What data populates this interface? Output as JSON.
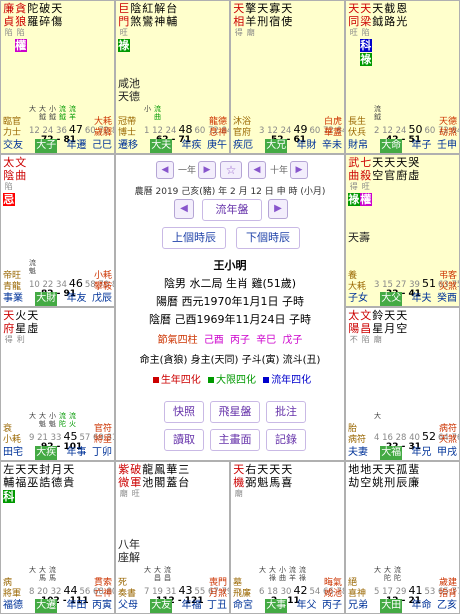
{
  "colors": {
    "lu": "#009900",
    "quan": "#cc00cc",
    "ke": "#0000cc",
    "ji": "#ff0000",
    "decade": "#44aa44",
    "highlight": "#ffffcc"
  },
  "palaces": [
    {
      "id": "jisi",
      "stars": [
        {
          "name": "廉貞",
          "color": "#cc0000",
          "sub": "陷"
        },
        {
          "name": "貪狼",
          "color": "#cc0000",
          "sub": "陷",
          "hua": "權",
          "hua_bg": "#cc00cc"
        },
        {
          "name": "陀羅",
          "color": "#000000"
        },
        {
          "name": "破碎",
          "color": "#000000"
        },
        {
          "name": "天傷",
          "color": "#000000"
        }
      ],
      "subs": [],
      "tiny": [
        {
          "t": "大",
          "g": false
        },
        {
          "t": "大鉞",
          "g": false
        },
        {
          "t": "小鉞",
          "g": false
        },
        {
          "t": "流鉞",
          "g": true
        },
        {
          "t": "流羊",
          "g": true
        }
      ],
      "age": {
        "pre": "12 24 36",
        "big": "47",
        "post": "60 72 84"
      },
      "decade": "72 - 81",
      "ls": "臨官\n力士",
      "rs": "大耗\n歲驛",
      "foot": {
        "l": "交友",
        "m": "大子",
        "r": "年遷",
        "gz": "己巳"
      }
    },
    {
      "id": "wuwu",
      "stars": [
        {
          "name": "巨門",
          "color": "#cc0000",
          "sub": "旺",
          "hua": "祿",
          "hua_bg": "#009900"
        },
        {
          "name": "陰煞",
          "color": "#000000"
        },
        {
          "name": "紅鸞",
          "color": "#000000"
        },
        {
          "name": "解神",
          "color": "#000000"
        },
        {
          "name": "台輔",
          "color": "#000000"
        }
      ],
      "subs": [
        "咸池",
        "天德"
      ],
      "tiny": [
        {
          "t": "小",
          "g": false
        },
        {
          "t": "流曲",
          "g": true
        }
      ],
      "age": {
        "pre": "1 12 24",
        "big": "48",
        "post": "60 72 84"
      },
      "decade": "62 - 71",
      "ls": "冠帶\n博士",
      "rs": "龍德\n息神",
      "foot": {
        "l": "遷移",
        "m": "大夫",
        "r": "年疾",
        "gz": "庚午"
      }
    },
    {
      "id": "xinwei",
      "stars": [
        {
          "name": "天相",
          "color": "#cc0000",
          "sub": "得"
        },
        {
          "name": "擎羊",
          "color": "#000000",
          "sub": "廟"
        },
        {
          "name": "天刑",
          "color": "#000000"
        },
        {
          "name": "寡宿",
          "color": "#000000"
        },
        {
          "name": "天使",
          "color": "#000000"
        }
      ],
      "subs": [],
      "tiny": [],
      "age": {
        "pre": "3 12 24",
        "big": "49",
        "post": "60 72 84"
      },
      "decade": "52 - 61",
      "ls": "沐浴\n官府",
      "rs": "白虎\n華蓋",
      "foot": {
        "l": "疾厄",
        "m": "大兄",
        "r": "年財",
        "gz": "辛未"
      }
    },
    {
      "id": "renshen",
      "stars": [
        {
          "name": "天同",
          "color": "#cc0000",
          "sub": "旺"
        },
        {
          "name": "天梁",
          "color": "#cc0000",
          "sub": "陷",
          "hua": "科",
          "hua_bg": "#0000cc",
          "hua2": "祿",
          "hua2_bg": "#009900"
        },
        {
          "name": "天鉞",
          "color": "#000000"
        },
        {
          "name": "截路",
          "color": "#000000"
        },
        {
          "name": "恩光",
          "color": "#000000"
        }
      ],
      "subs": [],
      "tiny": [
        {
          "t": "流鉞",
          "g": false
        }
      ],
      "age": {
        "pre": "2 12 24",
        "big": "50",
        "post": "60 72 84"
      },
      "decade": "42 - 51",
      "ls": "長生\n伏兵",
      "rs": "天德\n劫煞",
      "foot": {
        "l": "財帛",
        "m": "大命",
        "r": "年子",
        "gz": "壬申"
      }
    },
    {
      "id": "wuchen",
      "stars": [
        {
          "name": "太陰",
          "color": "#cc0000",
          "sub": "陷",
          "hua": "忌",
          "hua_bg": "#ff0000"
        },
        {
          "name": "文曲",
          "color": "#cc0000"
        }
      ],
      "subs": [],
      "tiny": [
        {
          "t": "流魁",
          "g": false
        }
      ],
      "age": {
        "pre": "10 22 34",
        "big": "46",
        "post": "58 70 82"
      },
      "decade": "82 - 91",
      "ls": "帝旺\n青龍",
      "rs": "小耗\n攀鞍",
      "foot": {
        "l": "事業",
        "m": "大財",
        "r": "年友",
        "gz": "戊辰"
      }
    },
    {
      "id": "guiyou",
      "stars": [
        {
          "name": "武曲",
          "color": "#cc0000",
          "sub": "得",
          "hua": "祿",
          "hua_bg": "#009900"
        },
        {
          "name": "七殺",
          "color": "#cc0000",
          "sub": "旺",
          "hua": "權",
          "hua_bg": "#cc00cc"
        },
        {
          "name": "天空",
          "color": "#000000"
        },
        {
          "name": "天官",
          "color": "#000000"
        },
        {
          "name": "天廚",
          "color": "#000000"
        },
        {
          "name": "哭虛",
          "color": "#000000"
        }
      ],
      "subs": [
        "天壽"
      ],
      "tiny": [],
      "age": {
        "pre": "3 15 27 39",
        "big": "51",
        "post": "63 75"
      },
      "decade": "32 - 41",
      "ls": "養\n大耗",
      "rs": "弔客\n災煞",
      "foot": {
        "l": "子女",
        "m": "大父",
        "r": "年夫",
        "gz": "癸酉"
      }
    },
    {
      "id": "dingmao",
      "stars": [
        {
          "name": "天府",
          "color": "#cc0000",
          "sub": "得"
        },
        {
          "name": "火星",
          "color": "#000000",
          "sub": "利"
        },
        {
          "name": "天虛",
          "color": "#000000"
        }
      ],
      "subs": [],
      "tiny": [
        {
          "t": "大",
          "g": false
        },
        {
          "t": "大魁",
          "g": false
        },
        {
          "t": "小魁",
          "g": false
        },
        {
          "t": "流陀",
          "g": true
        },
        {
          "t": "流火",
          "g": true
        }
      ],
      "age": {
        "pre": "9 21 33",
        "big": "45",
        "post": "57 69 81"
      },
      "decade": "92 - 101",
      "ls": "衰\n小耗",
      "rs": "官符\n將星",
      "foot": {
        "l": "田宅",
        "m": "大疾",
        "r": "年事",
        "gz": "丁卯"
      }
    },
    {
      "id": "jiaxu",
      "stars": [
        {
          "name": "太陽",
          "color": "#cc0000",
          "sub": "不"
        },
        {
          "name": "文昌",
          "color": "#cc0000",
          "sub": "陷"
        },
        {
          "name": "鈴星",
          "color": "#000000",
          "sub": "廟"
        },
        {
          "name": "天月",
          "color": "#000000"
        },
        {
          "name": "天空",
          "color": "#000000"
        }
      ],
      "subs": [],
      "tiny": [
        {
          "t": "大",
          "g": false
        }
      ],
      "age": {
        "pre": "4 16 28 40",
        "big": "52",
        "post": "64 76"
      },
      "decade": "22 - 31",
      "ls": "胎\n病符",
      "rs": "病符\n天煞",
      "foot": {
        "l": "夫妻",
        "m": "大福",
        "r": "年兄",
        "gz": "甲戌"
      }
    },
    {
      "id": "bingyin",
      "stars": [
        {
          "name": "左輔",
          "color": "#000000",
          "hua": "科",
          "hua_bg": "#009900"
        },
        {
          "name": "天福",
          "color": "#000000"
        },
        {
          "name": "天巫",
          "color": "#000000"
        },
        {
          "name": "封誥",
          "color": "#000000"
        },
        {
          "name": "月德",
          "color": "#000000"
        },
        {
          "name": "天貴",
          "color": "#000000"
        }
      ],
      "subs": [],
      "tiny": [
        {
          "t": "大",
          "g": false
        },
        {
          "t": "大馬",
          "g": false
        },
        {
          "t": "流馬",
          "g": false
        }
      ],
      "age": {
        "pre": "8 20 32",
        "big": "44",
        "post": "56 68 80"
      },
      "decade": "102 - 111",
      "ls": "病\n將軍",
      "rs": "貫索\n亡神",
      "foot": {
        "l": "福德",
        "m": "大遷",
        "r": "年田",
        "gz": "丙寅"
      }
    },
    {
      "id": "dingchou",
      "stars": [
        {
          "name": "紫微",
          "color": "#cc0000",
          "sub": "廟"
        },
        {
          "name": "破軍",
          "color": "#cc0000",
          "sub": "旺"
        },
        {
          "name": "龍池",
          "color": "#000000"
        },
        {
          "name": "鳳閣",
          "color": "#000000"
        },
        {
          "name": "華蓋",
          "color": "#000000"
        },
        {
          "name": "三台",
          "color": "#000000"
        }
      ],
      "subs": [
        "八年",
        "座解"
      ],
      "tiny": [
        {
          "t": "大",
          "g": false
        },
        {
          "t": "大昌",
          "g": false
        },
        {
          "t": "流昌",
          "g": false
        }
      ],
      "age": {
        "pre": "7 19 31",
        "big": "43",
        "post": "55 67 79"
      },
      "decade": "112 - 121",
      "ls": "死\n奏書",
      "rs": "喪門\n月煞",
      "foot": {
        "l": "父母",
        "m": "大友",
        "r": "年福",
        "gz": "丁丑"
      }
    },
    {
      "id": "bingzi",
      "stars": [
        {
          "name": "天機",
          "color": "#cc0000",
          "sub": "廟"
        },
        {
          "name": "右弼",
          "color": "#000000"
        },
        {
          "name": "天魁",
          "color": "#000000"
        },
        {
          "name": "天馬",
          "color": "#000000"
        },
        {
          "name": "天喜",
          "color": "#000000"
        }
      ],
      "subs": [],
      "tiny": [
        {
          "t": "大",
          "g": false
        },
        {
          "t": "大祿",
          "g": false
        },
        {
          "t": "小曲",
          "g": false
        },
        {
          "t": "流羊",
          "g": false
        },
        {
          "t": "流祿",
          "g": false
        }
      ],
      "age": {
        "pre": "6 18 30",
        "big": "42",
        "post": "54 66 78"
      },
      "decade": "2 - 11",
      "ls": "墓\n飛廉",
      "rs": "晦氣\n咸池",
      "foot": {
        "l": "命宮",
        "m": "大事",
        "r": "年父",
        "gz": "丙子"
      }
    },
    {
      "id": "yihai",
      "stars": [
        {
          "name": "地劫",
          "color": "#000000"
        },
        {
          "name": "地空",
          "color": "#000000"
        },
        {
          "name": "天姚",
          "color": "#000000"
        },
        {
          "name": "天刑",
          "color": "#000000"
        },
        {
          "name": "孤辰",
          "color": "#000000"
        },
        {
          "name": "蜚廉",
          "color": "#000000"
        }
      ],
      "subs": [],
      "tiny": [
        {
          "t": "大",
          "g": false
        },
        {
          "t": "大陀",
          "g": false
        },
        {
          "t": "流陀",
          "g": false
        }
      ],
      "age": {
        "pre": "5 17 29",
        "big": "41",
        "post": "53 65 77"
      },
      "decade": "12 - 21",
      "ls": "絕\n喜神",
      "rs": "歲建\n指背",
      "foot": {
        "l": "兄弟",
        "m": "大田",
        "r": "年命",
        "gz": "乙亥"
      }
    }
  ],
  "center": {
    "nav": {
      "year_prev": "◀",
      "year_label": "一年",
      "year_next": "▶",
      "star": "☆",
      "hour_prev": "◀",
      "hour_label": "十年",
      "hour_next": "▶"
    },
    "lunar_line": "農曆 2019 己亥(豬) 年 2 月 12 日 申 時 (小月)",
    "liupan": {
      "prev": "◀",
      "label": "流年盤",
      "next": "▶"
    },
    "btn_prev_hour": "上個時辰",
    "btn_next_hour": "下個時辰",
    "name": "王小明",
    "yinyang": "陰男 水二局 生肖 雞(51歲)",
    "solar": "陽曆 西元1970年1月1日 子時",
    "lunar": "陰曆 己酉1969年11月24日 子時",
    "four_pillars_label": "節氣四柱",
    "pillars": [
      "己酉",
      "丙子",
      "辛巳",
      "戊子"
    ],
    "zhu": "命主(貪狼) 身主(天同) 子斗(寅) 流斗(丑)",
    "legend": {
      "sheng": "生年四化",
      "da": "大限四化",
      "liu": "流年四化"
    },
    "buttons": [
      "快照",
      "飛星盤",
      "批注",
      "讀取",
      "主畫面",
      "記錄"
    ]
  }
}
